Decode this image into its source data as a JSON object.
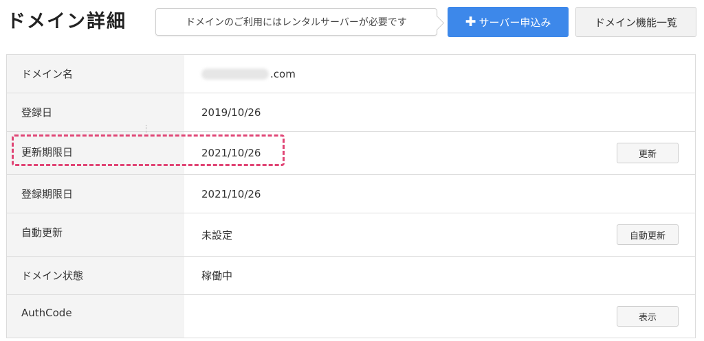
{
  "header": {
    "title": "ドメイン詳細",
    "callout_text": "ドメインのご利用にはレンタルサーバーが必要です",
    "apply_button_label": "サーバー申込み",
    "features_button_label": "ドメイン機能一覧"
  },
  "rows": [
    {
      "label": "ドメイン名",
      "value": ".com",
      "value_prefix_blurred": true
    },
    {
      "label": "登録日",
      "value": "2019/10/26"
    },
    {
      "label": "更新期限日",
      "value": "2021/10/26",
      "button": "更新"
    },
    {
      "label": "登録期限日",
      "value": "2021/10/26"
    },
    {
      "label": "自動更新",
      "value": "未設定",
      "button": "自動更新"
    },
    {
      "label": "ドメイン状態",
      "value": "稼働中"
    },
    {
      "label": "AuthCode",
      "value": "",
      "button": "表示"
    }
  ],
  "colors": {
    "primary_button": "#3d88ea",
    "highlight": "#e04575",
    "label_background": "#f4f4f4"
  },
  "icons": {
    "apply_button_icon": "plus-icon"
  }
}
